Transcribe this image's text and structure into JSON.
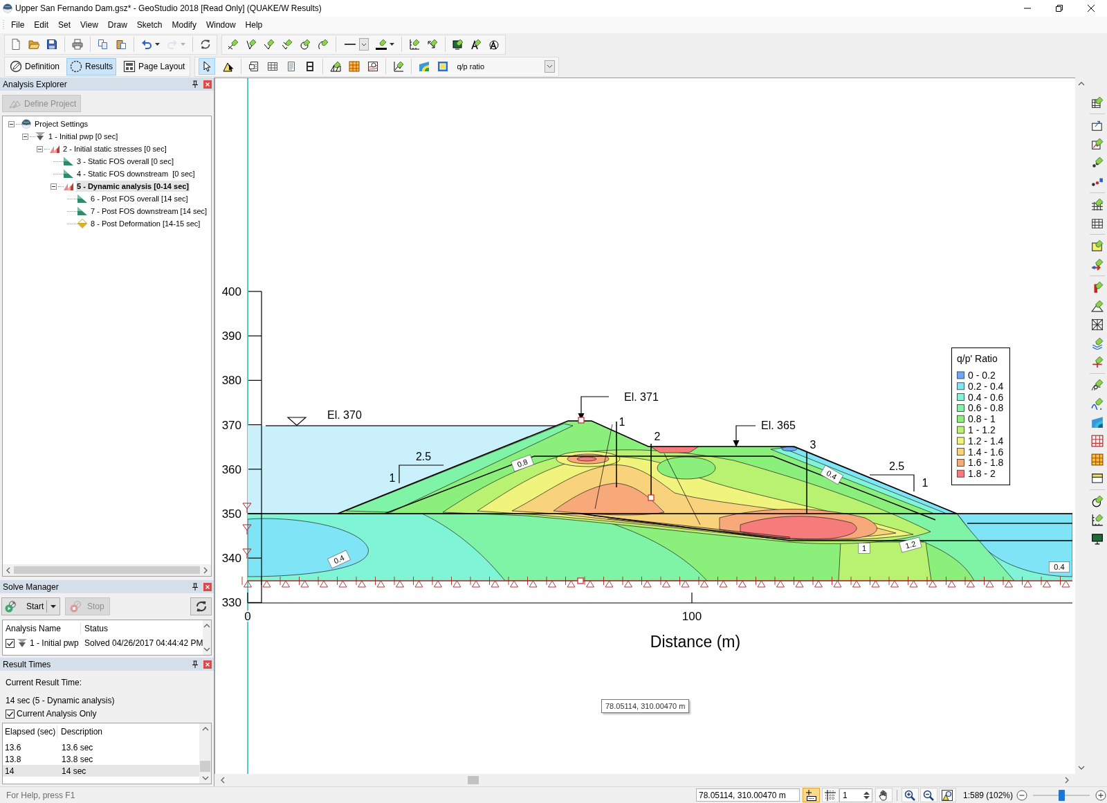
{
  "window": {
    "title": "Upper San Fernando Dam.gsz* - GeoStudio 2018 [Read Only] (QUAKE/W Results)"
  },
  "menu": [
    "File",
    "Edit",
    "Set",
    "View",
    "Draw",
    "Sketch",
    "Modify",
    "Window",
    "Help"
  ],
  "toolbars": [
    {
      "groups": [
        [
          {
            "kind": "new",
            "disabled": false
          },
          {
            "kind": "open",
            "disabled": false
          },
          {
            "kind": "save",
            "disabled": false
          }
        ],
        [
          {
            "kind": "print",
            "disabled": false
          }
        ],
        [
          {
            "kind": "copy",
            "disabled": false
          },
          {
            "kind": "paste",
            "disabled": false
          }
        ],
        [
          {
            "kind": "undo",
            "disabled": false
          },
          {
            "kind": "redo",
            "disabled": true
          }
        ],
        [
          {
            "kind": "refresh",
            "disabled": false
          }
        ]
      ]
    },
    {
      "groups": [
        [
          {
            "kind": "sketch-line",
            "disabled": false
          },
          {
            "kind": "sketch-lines",
            "disabled": false
          },
          {
            "kind": "sketch-polyline",
            "disabled": false
          },
          {
            "kind": "sketch-arrows",
            "disabled": false
          },
          {
            "kind": "sketch-circle",
            "disabled": false
          },
          {
            "kind": "sketch-arc",
            "disabled": false
          }
        ],
        [
          {
            "kind": "line-style",
            "disabled": false
          },
          {
            "kind": "line-color",
            "disabled": false
          }
        ],
        [
          {
            "kind": "axes",
            "disabled": false
          },
          {
            "kind": "dimension",
            "disabled": false
          }
        ],
        [
          {
            "kind": "screen",
            "disabled": false
          },
          {
            "kind": "text",
            "disabled": false
          },
          {
            "kind": "text-format",
            "disabled": false
          }
        ]
      ]
    }
  ],
  "view_toolbar": {
    "modes": [
      {
        "kind": "definition",
        "label": "Definition",
        "selected": false
      },
      {
        "kind": "results",
        "label": "Results",
        "selected": true
      },
      {
        "kind": "layout",
        "label": "Page Layout",
        "selected": false
      }
    ],
    "groups": [
      [
        {
          "kind": "select",
          "selected": true
        },
        {
          "kind": "contour-cursor",
          "selected": false
        }
      ],
      [
        {
          "kind": "report",
          "selected": false
        },
        {
          "kind": "table",
          "selected": false
        },
        {
          "kind": "document",
          "selected": false
        },
        {
          "kind": "film",
          "selected": false
        }
      ],
      [
        {
          "kind": "mesh",
          "selected": false
        },
        {
          "kind": "grid-map",
          "selected": false
        },
        {
          "kind": "contour-map",
          "selected": false
        }
      ],
      [
        {
          "kind": "graph",
          "selected": false
        }
      ],
      [
        {
          "kind": "color-contour",
          "selected": false
        },
        {
          "kind": "color-scale",
          "selected": false
        }
      ]
    ],
    "result_type": "q/p ratio"
  },
  "analysis_explorer": {
    "title": "Analysis Explorer",
    "define_button": {
      "label": "Define Project",
      "disabled": true
    },
    "tree": [
      {
        "kind": "settings",
        "label": "Project Settings",
        "selected": false,
        "expanded": true,
        "children": [
          {
            "kind": "seepage",
            "label": "1 - Initial pwp [0 sec]",
            "selected": false,
            "expanded": true,
            "children": [
              {
                "kind": "stress",
                "label": "2 - Initial static stresses [0 sec]",
                "selected": false,
                "expanded": true,
                "children": [
                  {
                    "kind": "slope",
                    "label": "3 - Static FOS overall [0 sec]",
                    "selected": false
                  },
                  {
                    "kind": "slope",
                    "label": "4 - Static FOS downstream  [0 sec]",
                    "selected": false
                  },
                  {
                    "kind": "stress",
                    "label": "5 - Dynamic analysis [0-14 sec]",
                    "selected": true,
                    "expanded": true,
                    "children": [
                      {
                        "kind": "slope",
                        "label": "6 - Post FOS overall [14 sec]",
                        "selected": false
                      },
                      {
                        "kind": "slope",
                        "label": "7 - Post FOS downstream [14 sec]",
                        "selected": false
                      },
                      {
                        "kind": "deformation",
                        "label": "8 - Post Deformation [14-15 sec]",
                        "selected": false
                      }
                    ]
                  }
                ]
              }
            ]
          }
        ]
      }
    ]
  },
  "solve_manager": {
    "title": "Solve Manager",
    "start": {
      "label": "Start",
      "disabled": false
    },
    "stop": {
      "label": "Stop",
      "disabled": true
    },
    "columns": [
      "Analysis Name",
      "Status"
    ],
    "rows": [
      {
        "kind": "seepage",
        "checked": true,
        "name": "1 - Initial pwp",
        "status": "Solved 04/26/2017 04:44:42 PM"
      }
    ]
  },
  "result_times": {
    "title": "Result Times",
    "current_label": "Current Result Time:",
    "current_value": "14 sec (5 - Dynamic analysis)",
    "current_only": {
      "label": "Current Analysis Only",
      "checked": true
    },
    "columns": [
      "Elapsed (sec)",
      "Description"
    ],
    "rows": [
      {
        "elapsed": "13.6",
        "description": "13.6 sec",
        "selected": false
      },
      {
        "elapsed": "13.8",
        "description": "13.8 sec",
        "selected": false
      },
      {
        "elapsed": "14",
        "description": "14 sec",
        "selected": true
      }
    ]
  },
  "canvas": {
    "y_ticks": [
      "400",
      "390",
      "380",
      "370",
      "360",
      "350",
      "340",
      "330"
    ],
    "x_ticks": [
      "0",
      "100"
    ],
    "x_label": "Distance (m)",
    "water_level": "El. 370",
    "elevation_markers": [
      "El. 371",
      "El. 365"
    ],
    "sections": [
      "1",
      "2",
      "3"
    ],
    "slope_ratios": [
      {
        "run": "2.5",
        "rise": "1"
      },
      {
        "run": "2.5",
        "rise": "1"
      }
    ],
    "contour_labels": [
      "0.8",
      "0.4",
      "0.4",
      "1",
      "1.2",
      "0.4"
    ],
    "legend": {
      "title": "q/p' Ratio",
      "items": [
        {
          "label": "0 - 0.2",
          "color": "#6ea8f2"
        },
        {
          "label": "0.2 - 0.4",
          "color": "#7fe5f6"
        },
        {
          "label": "0.4 - 0.6",
          "color": "#7ff5d5"
        },
        {
          "label": "0.6 - 0.8",
          "color": "#80f4a6"
        },
        {
          "label": "0.8 - 1",
          "color": "#8bef7c"
        },
        {
          "label": "1 - 1.2",
          "color": "#b9f170"
        },
        {
          "label": "1.2 - 1.4",
          "color": "#f1f47c"
        },
        {
          "label": "1.4 - 1.6",
          "color": "#f8d37c"
        },
        {
          "label": "1.6 - 1.8",
          "color": "#f8a979"
        },
        {
          "label": "1.8 - 2",
          "color": "#f67c7c"
        }
      ]
    },
    "tooltip": "78.05114, 310.00470 m"
  },
  "status_bar": {
    "help": "For Help, press F1",
    "coordinates": "78.05114, 310.00470 m",
    "tools": [
      {
        "kind": "snap",
        "on": true
      },
      {
        "kind": "grid",
        "on": false
      }
    ],
    "grid_spacing": "1",
    "view_tools": [
      {
        "kind": "pan",
        "on": false
      },
      {
        "kind": "zoom-in",
        "on": false
      },
      {
        "kind": "zoom-out",
        "on": false
      },
      {
        "kind": "zoom-fit",
        "on": false
      }
    ],
    "scale": "1:589 (102%)",
    "zoom": {
      "level": 0.5
    }
  }
}
